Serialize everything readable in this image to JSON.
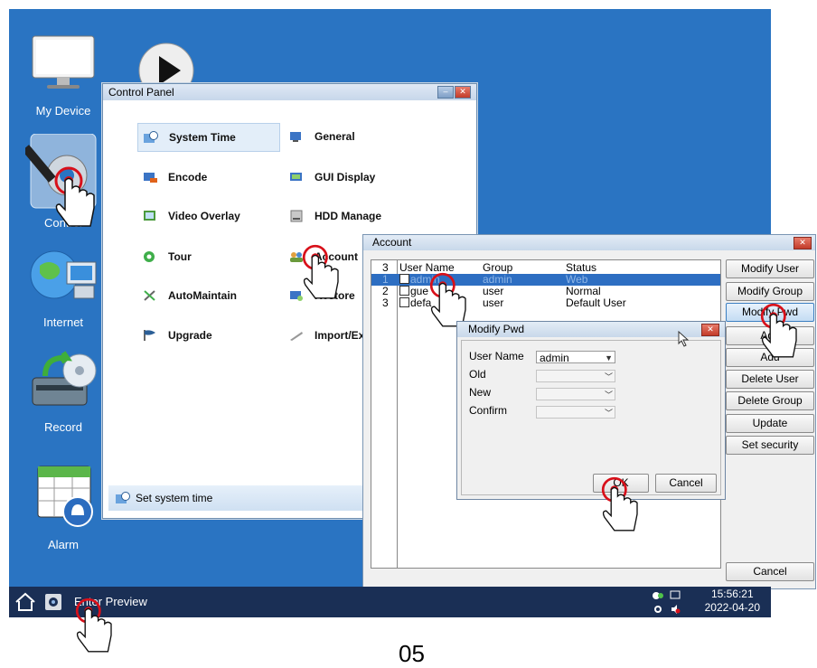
{
  "desktop": {
    "icons": [
      {
        "name": "my-device",
        "label": "My Device"
      },
      {
        "name": "control",
        "label": "Control"
      },
      {
        "name": "internet",
        "label": "Internet"
      },
      {
        "name": "record",
        "label": "Record"
      },
      {
        "name": "alarm",
        "label": "Alarm"
      },
      {
        "name": "play",
        "label": ""
      }
    ]
  },
  "control_panel": {
    "title": "Control Panel",
    "items": [
      {
        "label": "System Time",
        "icon": "clock-icon"
      },
      {
        "label": "General",
        "icon": "general-icon"
      },
      {
        "label": "Encode",
        "icon": "encode-icon"
      },
      {
        "label": "GUI Display",
        "icon": "display-icon"
      },
      {
        "label": "Video Overlay",
        "icon": "overlay-icon"
      },
      {
        "label": "HDD Manage",
        "icon": "hdd-icon"
      },
      {
        "label": "Tour",
        "icon": "tour-icon"
      },
      {
        "label": "Account",
        "icon": "account-icon"
      },
      {
        "label": "AutoMaintain",
        "icon": "tools-icon"
      },
      {
        "label": "Restore",
        "icon": "restore-icon"
      },
      {
        "label": "Upgrade",
        "icon": "flag-icon"
      },
      {
        "label": "Import/Ex",
        "icon": "import-icon"
      }
    ],
    "status": "Set system time"
  },
  "account": {
    "title": "Account",
    "headers": [
      "3",
      "User Name",
      "Group",
      "Status"
    ],
    "rows": [
      {
        "num": "1",
        "user": "admin",
        "group": "admin",
        "status": "Web"
      },
      {
        "num": "2",
        "user": "gue",
        "group": "user",
        "status": "Normal"
      },
      {
        "num": "3",
        "user": "defa",
        "group": "user",
        "status": "Default User"
      }
    ],
    "buttons": [
      "Modify User",
      "Modify Group",
      "Modify Pwd",
      "Add",
      "Add",
      "Delete User",
      "Delete Group",
      "Update",
      "Set security"
    ],
    "cancel": "Cancel"
  },
  "modify_pwd": {
    "title": "Modify Pwd",
    "user_name_label": "User Name",
    "user_name_value": "admin",
    "old_label": "Old",
    "new_label": "New",
    "confirm_label": "Confirm",
    "ok": "OK",
    "cancel": "Cancel"
  },
  "taskbar": {
    "text": "Enter Preview",
    "time": "15:56:21",
    "date": "2022-04-20"
  },
  "page_number": "05",
  "colors": {
    "desktop": "#2a74c2",
    "taskbar": "#1a2f55",
    "selection": "#2d6ec2",
    "click_marker": "#d8101a"
  }
}
